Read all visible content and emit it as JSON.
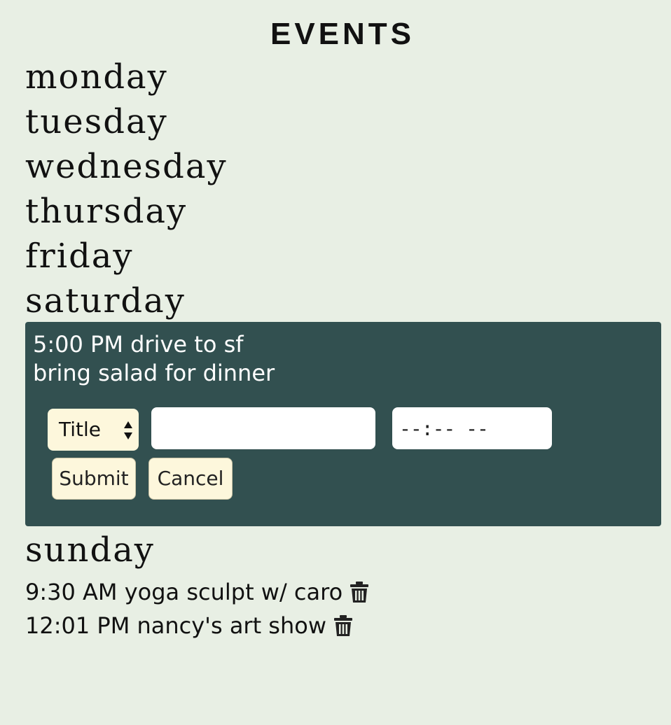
{
  "header": {
    "title": "EVENTS"
  },
  "days": [
    "monday",
    "tuesday",
    "wednesday",
    "thursday",
    "friday",
    "saturday",
    "sunday"
  ],
  "saturday_panel": {
    "notes": [
      "5:00 PM drive to sf",
      "bring salad for dinner"
    ],
    "type_select": {
      "selected": "Title"
    },
    "text_input": {
      "value": ""
    },
    "time_input": {
      "placeholder": "--:-- --"
    },
    "submit_label": "Submit",
    "cancel_label": "Cancel"
  },
  "sunday_events": [
    {
      "text": "9:30 AM yoga sculpt w/ caro"
    },
    {
      "text": "12:01 PM nancy's art show"
    }
  ],
  "colors": {
    "background": "#e8efe4",
    "panel": "#325050",
    "button": "#fdf7dc"
  },
  "icons": {
    "delete": "trash-icon"
  }
}
